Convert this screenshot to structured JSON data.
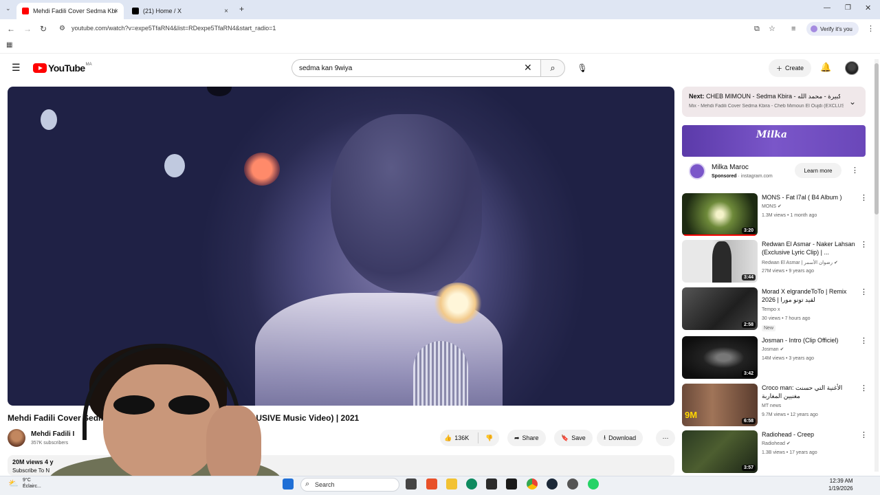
{
  "browser": {
    "tabs": [
      {
        "title": "Mehdi Fadili Cover Sedma Kbi",
        "active": true,
        "favicon_color": "#ff0000"
      },
      {
        "title": "(21) Home / X",
        "active": false,
        "favicon_color": "#000000"
      }
    ],
    "url": "youtube.com/watch?v=expe5TfaRN4&list=RDexpe5TfaRN4&start_radio=1",
    "verify_label": "Verify it's you",
    "new_tab": "+",
    "close_tab": "×"
  },
  "youtube": {
    "logo_text": "YouTube",
    "country_code": "MA",
    "search_value": "sedma kan 9wiya",
    "create_label": "Create"
  },
  "video": {
    "title": "Mehdi Fadili Cover Sedma Kbira - Cheb Mimoun El Oujdi (EXCLUSIVE Music Video) | 2021",
    "channel": "Mehdi Fadili I",
    "subscribers": "357K subscribers",
    "likes": "136K",
    "share_label": "Share",
    "save_label": "Save",
    "download_label": "Download",
    "views_meta": "20M views  4 y",
    "desc_sub": "Subscribe To N"
  },
  "sidebar": {
    "next": {
      "label": "Next:",
      "title": "CHEB MIMOUN - Sedma Kbira - صدمة كبيرة - محمد الله",
      "subtitle": "Mix - Mehdi Fadili Cover Sedma Kbira - Cheb Mimoun El Oujdi (EXCLUSIVE Music Video)"
    },
    "ad": {
      "brand_logo": "Milka",
      "name": "Milka Maroc",
      "sponsored": "Sponsored",
      "domain": "instagram.com",
      "cta": "Learn more"
    },
    "recommendations": [
      {
        "title": "MONS - Fat l7al ( B4 Album )",
        "channel": "MONS",
        "verified": true,
        "meta": "1.3M views • 1 month ago",
        "duration": "3:20",
        "badge": "",
        "thumb": "#2c3a1e"
      },
      {
        "title": "Redwan El Asmar - Naker Lahsan (Exclusive Lyric Clip) | ...",
        "channel": "Redwan El Asmar | رضوان الأسمر",
        "verified": true,
        "meta": "27M views • 9 years ago",
        "duration": "3:44",
        "badge": "",
        "thumb": "#cfcfcf"
      },
      {
        "title": "Morad X elgrandeToTo | Remix 2026 | لقيد تونو مورا",
        "channel": "Tempo x",
        "verified": false,
        "meta": "30 views • 7 hours ago",
        "duration": "2:58",
        "badge": "New",
        "thumb": "#3a3a3a"
      },
      {
        "title": "Josman - Intro (Clip Officiel)",
        "channel": "Josman",
        "verified": true,
        "meta": "14M views • 3 years ago",
        "duration": "3:42",
        "badge": "",
        "thumb": "#161616"
      },
      {
        "title": "Croco man: الأغنية التي حسنت مغنيين المغاربة",
        "channel": "MT news",
        "verified": false,
        "meta": "9.7M views • 12 years ago",
        "duration": "6:58",
        "badge": "",
        "thumb": "#6b4a3a"
      },
      {
        "title": "Radiohead - Creep",
        "channel": "Radiohead",
        "verified": true,
        "meta": "1.3B views • 17 years ago",
        "duration": "3:57",
        "badge": "",
        "thumb": "#3a4a2a"
      }
    ]
  },
  "taskbar": {
    "search_placeholder": "Search",
    "time": "12:39 AM",
    "date": "1/19/2026",
    "weather_temp": "9°C",
    "weather_desc": "Éclairc..."
  },
  "colors": {
    "accent_red": "#ff0000",
    "ad_purple": "#7a56c9",
    "next_bg": "#f0e8ea"
  }
}
